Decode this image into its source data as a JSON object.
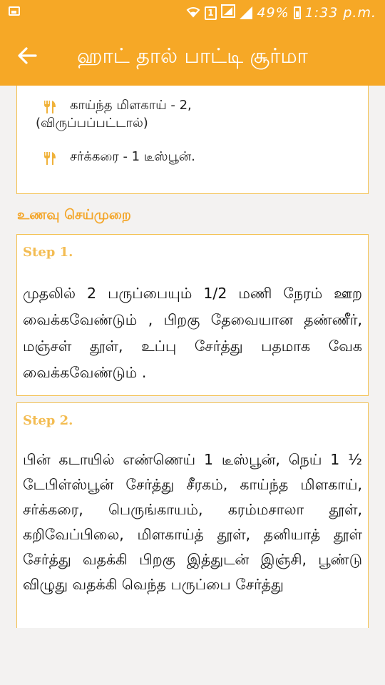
{
  "status_bar": {
    "sim_badge": "1",
    "battery": "49%",
    "time": "1:33 p.m."
  },
  "app_bar": {
    "title": "ஹாட் தால் பாட்டி சூர்மா",
    "back_icon": "arrow-left-icon"
  },
  "ingredients": [
    {
      "icon": "fork-knife-icon",
      "line1": "காய்ந்த மிளகாய் - 2,",
      "line2": "(விருப்பப்பட்டால்)"
    },
    {
      "icon": "fork-knife-icon",
      "line1": "சர்க்கரை - 1 டீஸ்பூன்."
    }
  ],
  "method_heading": "உணவு செய்முறை",
  "steps": [
    {
      "label": "Step 1.",
      "text": "முதலில் 2 பருப்பையும் 1/2 மணி நேரம் ஊற வைக்கவேண்டும் , பிறகு தேவையான தண்ணீர், மஞ்சள் தூள், உப்பு சேர்த்து பதமாக வேக வைக்கவேண்டும் ."
    },
    {
      "label": "Step 2.",
      "text": "பின் கடாயில் எண்ணெய் 1 டீஸ்பூன், நெய் 1 ½ டேபிள்ஸ்பூன் சேர்த்து சீரகம், காய்ந்த மிளகாய், சர்க்கரை, பெருங்காயம், கரம்மசாலா தூள், கறிவேப்பிலை, மிளகாய்த் தூள், தனியாத் தூள் சேர்த்து வதக்கி பிறகு இத்துடன் இஞ்சி, பூண்டு விழுது வதக்கி வெந்த பருப்பை சேர்த்து"
    }
  ],
  "colors": {
    "primary": "#f6a826",
    "card_border": "#f3c050",
    "step_label": "#f3bc52",
    "heading": "#f3a72c",
    "background": "#f3f2f1"
  }
}
